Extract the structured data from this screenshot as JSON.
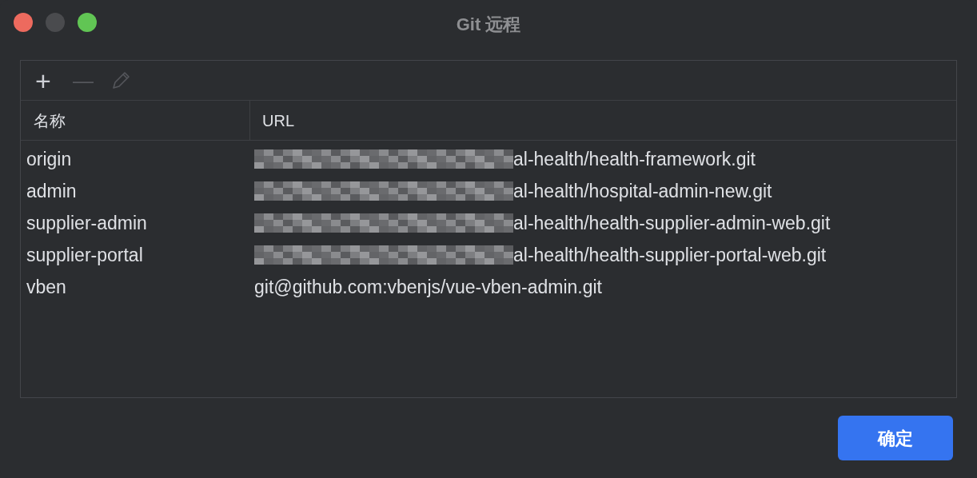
{
  "window": {
    "title": "Git 远程"
  },
  "toolbar": {
    "add": "+",
    "remove": "—"
  },
  "table": {
    "columns": [
      "名称",
      "URL"
    ],
    "rows": [
      {
        "name": "origin",
        "url": "al-health/health-framework.git",
        "redacted": true
      },
      {
        "name": "admin",
        "url": "al-health/hospital-admin-new.git",
        "redacted": true
      },
      {
        "name": "supplier-admin",
        "url": "al-health/health-supplier-admin-web.git",
        "redacted": true
      },
      {
        "name": "supplier-portal",
        "url": "al-health/health-supplier-portal-web.git",
        "redacted": true
      },
      {
        "name": "vben",
        "url": "git@github.com:vbenjs/vue-vben-admin.git",
        "redacted": false
      }
    ]
  },
  "buttons": [
    {
      "label": "确定",
      "kind": "primary"
    }
  ]
}
